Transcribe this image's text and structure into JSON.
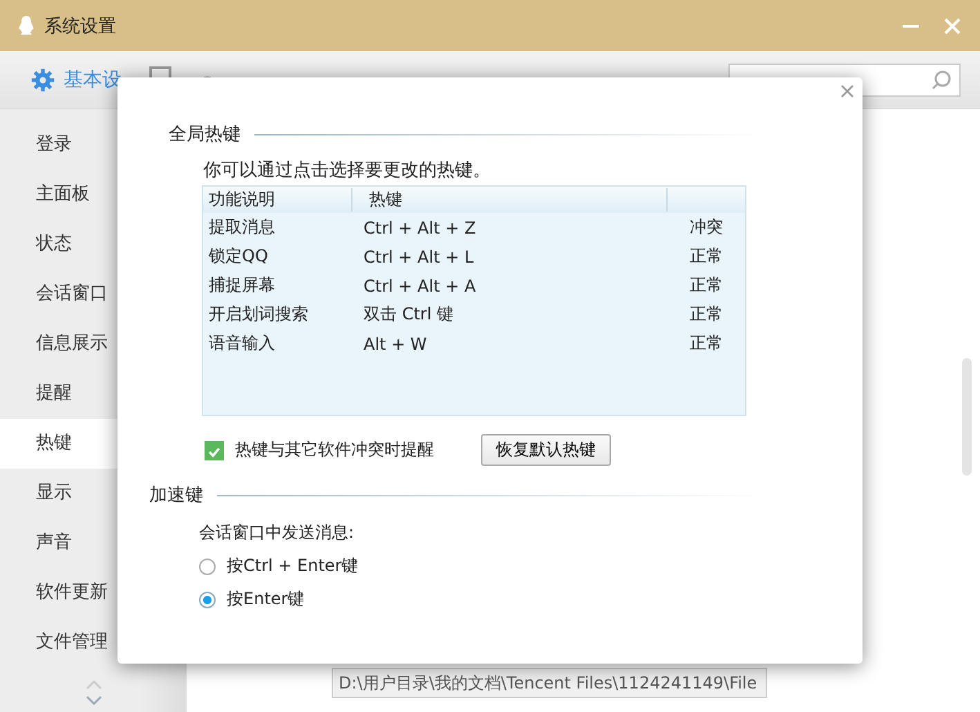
{
  "window": {
    "title": "系统设置"
  },
  "tabs": [
    {
      "label": "基本设",
      "selected": true
    },
    {
      "selected": false
    },
    {
      "selected": false
    }
  ],
  "sidebar": {
    "items": [
      {
        "label": "登录",
        "selected": false
      },
      {
        "label": "主面板",
        "selected": false
      },
      {
        "label": "状态",
        "selected": false
      },
      {
        "label": "会话窗口",
        "selected": false
      },
      {
        "label": "信息展示",
        "selected": false
      },
      {
        "label": "提醒",
        "selected": false
      },
      {
        "label": "热键",
        "selected": true
      },
      {
        "label": "显示",
        "selected": false
      },
      {
        "label": "声音",
        "selected": false
      },
      {
        "label": "软件更新",
        "selected": false
      },
      {
        "label": "文件管理",
        "selected": false
      }
    ]
  },
  "background": {
    "path": "D:\\用户目录\\我的文档\\Tencent Files\\1124241149\\File"
  },
  "dialog": {
    "global_hotkeys": {
      "title": "全局热键",
      "hint": "你可以通过点击选择要更改的热键。",
      "table": {
        "columns": [
          "功能说明",
          "热键"
        ],
        "rows": [
          {
            "function": "提取消息",
            "hotkey": "Ctrl + Alt + Z",
            "status": "冲突"
          },
          {
            "function": "锁定QQ",
            "hotkey": "Ctrl + Alt + L",
            "status": "正常"
          },
          {
            "function": "捕捉屏幕",
            "hotkey": "Ctrl + Alt + A",
            "status": "正常"
          },
          {
            "function": "开启划词搜索",
            "hotkey": "双击 Ctrl 键",
            "status": "正常"
          },
          {
            "function": "语音输入",
            "hotkey": "Alt + W",
            "status": "正常"
          }
        ]
      },
      "conflict_alert": {
        "label": "热键与其它软件冲突时提醒",
        "checked": true
      },
      "restore_button": "恢复默认热键"
    },
    "accelerator": {
      "title": "加速键",
      "prompt": "会话窗口中发送消息:",
      "options": [
        {
          "label": "按Ctrl + Enter键",
          "selected": false
        },
        {
          "label": "按Enter键",
          "selected": true
        }
      ]
    }
  }
}
